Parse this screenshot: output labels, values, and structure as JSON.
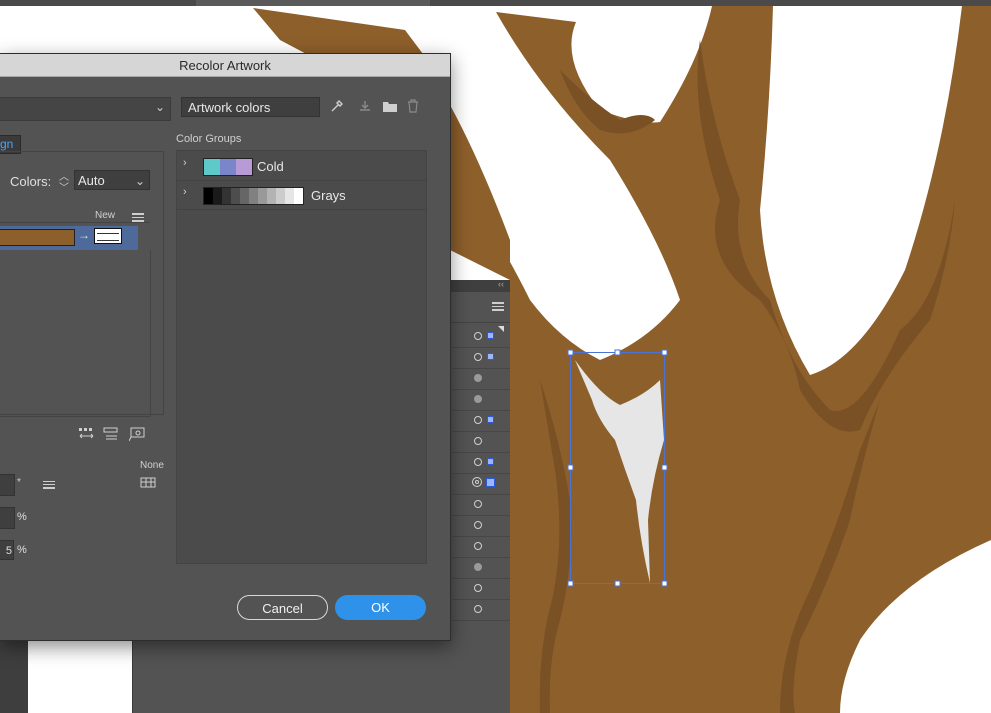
{
  "dialog": {
    "title": "Recolor Artwork",
    "colors_name": "Artwork colors",
    "tab_label": "gn",
    "colors_label": "Colors:",
    "colors_value": "Auto",
    "new_label": "New",
    "none_label": "None",
    "star": "*",
    "percent_b": "%",
    "field_c_value": "5",
    "percent_c": "%",
    "color_groups_label": "Color Groups",
    "cancel_label": "Cancel",
    "ok_label": "OK"
  },
  "color_groups": [
    {
      "name": "Cold",
      "swatches": [
        "#5fc8c8",
        "#7a86c9",
        "#b89ad6"
      ]
    },
    {
      "name": "Grays",
      "swatches": [
        "#000000",
        "#1a1a1a",
        "#333333",
        "#4d4d4d",
        "#666666",
        "#808080",
        "#999999",
        "#b3b3b3",
        "#cccccc",
        "#e6e6e6",
        "#ffffff"
      ]
    }
  ],
  "colors": {
    "artwork_brown": "#8d5f2b",
    "accent_blue": "#2f92ea",
    "selection_row": "#4d6a9b"
  },
  "icons": [
    "eyedropper-icon",
    "save-group-icon",
    "folder-icon",
    "trash-icon",
    "chevron-down-icon",
    "menu-icon"
  ]
}
